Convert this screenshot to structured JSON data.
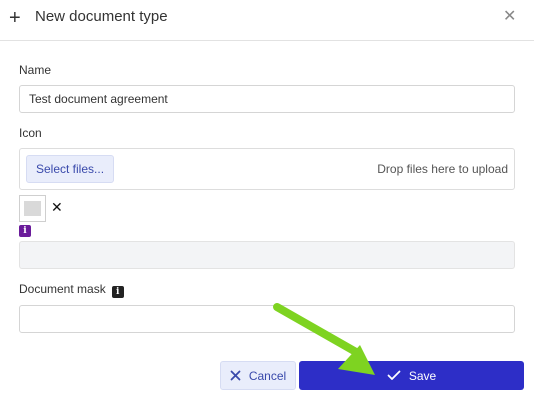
{
  "dialog": {
    "title": "New document type"
  },
  "form": {
    "name_label": "Name",
    "name_value": "Test document agreement",
    "icon_label": "Icon",
    "select_files_label": "Select files...",
    "drop_hint": "Drop files here to upload",
    "remove_glyph": "✕",
    "info_glyph": "i",
    "document_mask_label": "Document mask",
    "document_mask_value": ""
  },
  "footer": {
    "cancel_label": "Cancel",
    "save_label": "Save"
  },
  "colors": {
    "primary": "#2d2ec7",
    "secondary_bg": "#e9edfb",
    "secondary_text": "#3949ab",
    "info_badge": "#6a1b9a",
    "annotation_arrow": "#7ed321"
  },
  "icons": [
    "plus-icon",
    "close-icon",
    "remove-file-icon",
    "info-icon",
    "cancel-x-icon",
    "check-icon",
    "annotation-arrow"
  ]
}
